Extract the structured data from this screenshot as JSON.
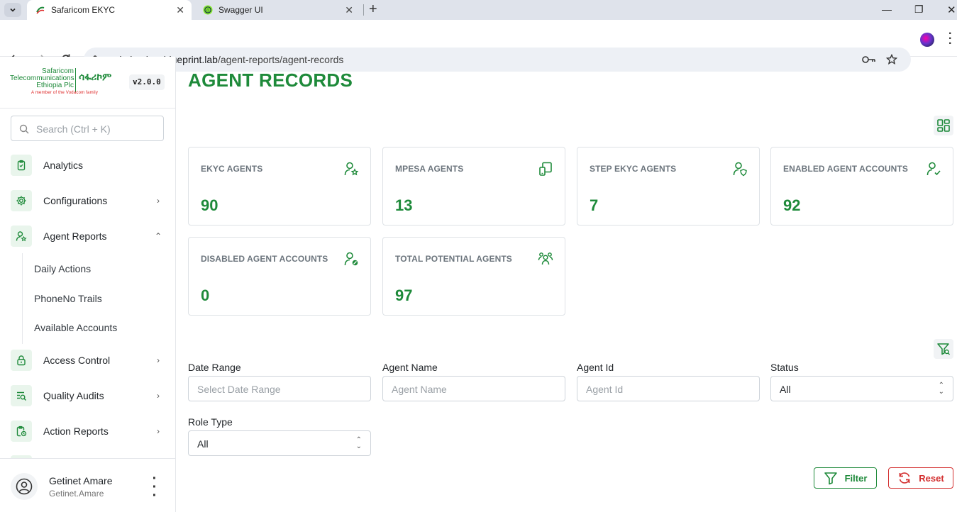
{
  "browser": {
    "tabs": [
      {
        "title": "Safaricom EKYC",
        "active": true
      },
      {
        "title": "Swagger UI",
        "active": false
      }
    ],
    "url_host": "admin.ekyc.blueprint.lab",
    "url_path": "/agent-reports/agent-records"
  },
  "sidebar": {
    "logo": {
      "line1": "Safaricom",
      "line2": "Telecommunications",
      "line3": "Ethiopia Plc",
      "amharic": "ሳፋሪኮም",
      "tagline": "A member of the Vodacom family"
    },
    "version": "v2.0.0",
    "search_placeholder": "Search (Ctrl + K)",
    "items": [
      {
        "label": "Analytics",
        "icon": "clipboard-icon"
      },
      {
        "label": "Configurations",
        "icon": "gear-icon"
      },
      {
        "label": "Agent Reports",
        "icon": "user-star-icon",
        "expanded": true
      },
      {
        "label": "Access Control",
        "icon": "lock-icon"
      },
      {
        "label": "Quality Audits",
        "icon": "list-search-icon"
      },
      {
        "label": "Action Reports",
        "icon": "clipboard-clock-icon"
      }
    ],
    "subitems": [
      "Daily Actions",
      "PhoneNo Trails",
      "Available Accounts"
    ],
    "user": {
      "name": "Getinet Amare",
      "username": "Getinet.Amare"
    }
  },
  "main": {
    "title": "AGENT RECORDS",
    "cards": [
      {
        "title": "EKYC AGENTS",
        "value": "90",
        "icon": "user-star-icon"
      },
      {
        "title": "MPESA AGENTS",
        "value": "13",
        "icon": "devices-icon"
      },
      {
        "title": "STEP EKYC AGENTS",
        "value": "7",
        "icon": "user-shield-icon"
      },
      {
        "title": "ENABLED AGENT ACCOUNTS",
        "value": "92",
        "icon": "user-check-icon"
      },
      {
        "title": "DISABLED AGENT ACCOUNTS",
        "value": "0",
        "icon": "user-disabled-icon"
      },
      {
        "title": "TOTAL POTENTIAL AGENTS",
        "value": "97",
        "icon": "users-group-icon"
      }
    ],
    "filters": {
      "date_range": {
        "label": "Date Range",
        "placeholder": "Select Date Range"
      },
      "agent_name": {
        "label": "Agent Name",
        "placeholder": "Agent Name"
      },
      "agent_id": {
        "label": "Agent Id",
        "placeholder": "Agent Id"
      },
      "status": {
        "label": "Status",
        "value": "All"
      },
      "role_type": {
        "label": "Role Type",
        "value": "All"
      }
    },
    "buttons": {
      "filter": "Filter",
      "reset": "Reset"
    }
  },
  "colors": {
    "brand_green": "#1e8a3a",
    "reset_red": "#d32f2f"
  }
}
